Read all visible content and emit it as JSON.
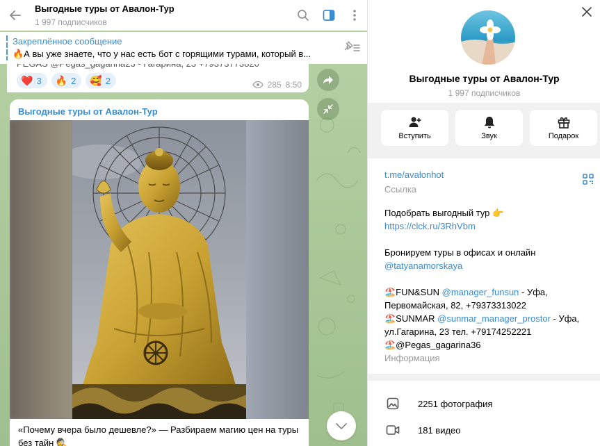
{
  "chat": {
    "title": "Выгодные туры от Авалон-Тур",
    "subscribers": "1 997 подписчиков"
  },
  "pinned": {
    "title": "Закреплённое сообщение",
    "text": "🔥А вы уже знаете, что у нас есть бот с горящими турами, который в..."
  },
  "message1": {
    "cut_text": "PEGAS @Pegas_gagarina23 - Гагарина, 23 +79373773820",
    "reactions": [
      {
        "emoji": "❤️",
        "count": "3"
      },
      {
        "emoji": "🔥",
        "count": "2"
      },
      {
        "emoji": "🥰",
        "count": "2"
      }
    ],
    "views": "285",
    "time": "8:50"
  },
  "message2": {
    "author": "Выгодные туры от Авалон-Тур",
    "caption": "«Почему вчера было дешевле?» — Разбираем магию цен на туры без тайн 🕵️"
  },
  "panel": {
    "name": "Выгодные туры от Авалон-Тур",
    "subscribers": "1 997 подписчиков",
    "actions": {
      "join": "Вступить",
      "sound": "Звук",
      "gift": "Подарок"
    },
    "link": "t.me/avalonhot",
    "link_label": "Ссылка",
    "desc": {
      "l1": "Подобрать выгодный тур 👉",
      "l2": "https://clck.ru/3RhVbm",
      "l3": "Бронируем туры в офисах и онлайн",
      "l4": "@tatyanamorskaya",
      "l5a": "🏖️FUN&SUN ",
      "l5b": "@manager_funsun",
      "l5c": " - Уфа,",
      "l6": "Первомайская, 82, +79373313022",
      "l7a": "🏖️SUNMAR ",
      "l7b": "@sunmar_manager_prostor",
      "l7c": " - Уфа,",
      "l8": "ул.Гагарина, 23 тел. +79174252221",
      "l9": "🏖️@Pegas_gagarina36"
    },
    "info_label": "Информация",
    "photos": "2251 фотография",
    "videos": "181 видео"
  },
  "colors": {
    "accent": "#3a8cd0",
    "chat_bg": "#aac79c",
    "gold": "#c9a233"
  }
}
